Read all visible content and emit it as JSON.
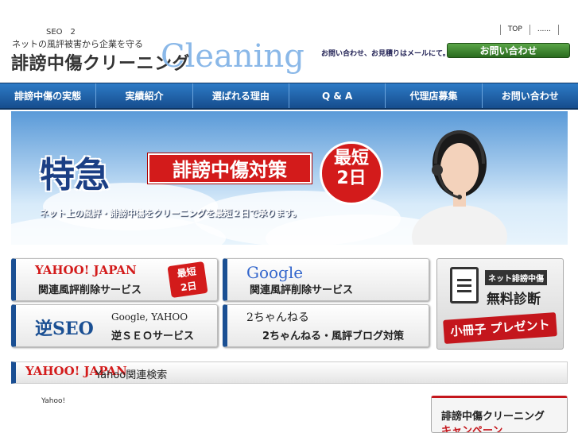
{
  "header": {
    "seo_text": "SEO　2",
    "top_links": [
      "TOP",
      "......"
    ],
    "logo": {
      "tagline": "ネットの風評被害から企業を守る",
      "name": "誹謗中傷クリーニング",
      "english": "Cleaning"
    },
    "inquiry_text": "お問い合わせ、お見積りはメールにて。",
    "inquiry_button": "お問い合わせ"
  },
  "nav": {
    "items": [
      "誹謗中傷の実態",
      "実績紹介",
      "選ばれる理由",
      "Q & A",
      "代理店募集",
      "お問い合わせ"
    ]
  },
  "hero": {
    "headline": "特急",
    "ribbon": "誹謗中傷対策",
    "bubble_line1": "最短",
    "bubble_line2": "2日",
    "sub": "ネット上の風評・誹謗中傷をクリーニングを最短２日で承ります。"
  },
  "services": [
    {
      "brand": "YAHOO! JAPAN",
      "label": "関連風評削除サービス",
      "badge1": "最短",
      "badge2": "2日"
    },
    {
      "brand": "Google",
      "label": "関連風評削除サービス"
    },
    {
      "brand": "逆SEO",
      "brand_sub": "Google, YAHOO",
      "label": "逆ＳＥＯサービス"
    },
    {
      "brand": "2ちゃんねる",
      "label": "2ちゃんねる・風評ブログ対策"
    }
  ],
  "diagnosis": {
    "tag": "ネット誹謗中傷",
    "title": "無料診断",
    "present": "小冊子 プレゼント"
  },
  "yahoo_search": {
    "logo": "YAHOO! JAPAN",
    "label": "Yahoo関連検索"
  },
  "body_text": "Yahoo!",
  "campaign": {
    "line1": "誹謗中傷クリーニング",
    "line2": "キャンペーン"
  },
  "colors": {
    "nav_blue": "#1f5fa8",
    "accent_red": "#d31b1b",
    "inquiry_green": "#3b8a2e"
  }
}
